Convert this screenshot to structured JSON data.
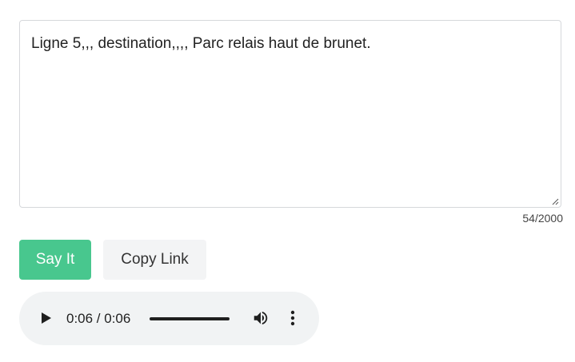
{
  "textarea": {
    "value": "Ligne 5,,, destination,,,, Parc relais haut de brunet.",
    "counter": "54/2000"
  },
  "buttons": {
    "say_it": "Say It",
    "copy_link": "Copy Link"
  },
  "audio": {
    "time": "0:06 / 0:06",
    "progress": 1.0
  },
  "colors": {
    "primary": "#48c78e",
    "secondary_bg": "#f3f4f5",
    "audio_bg": "#f1f3f4"
  },
  "icons": [
    "play-icon",
    "volume-icon",
    "more-vert-icon",
    "resize-grip-icon"
  ]
}
